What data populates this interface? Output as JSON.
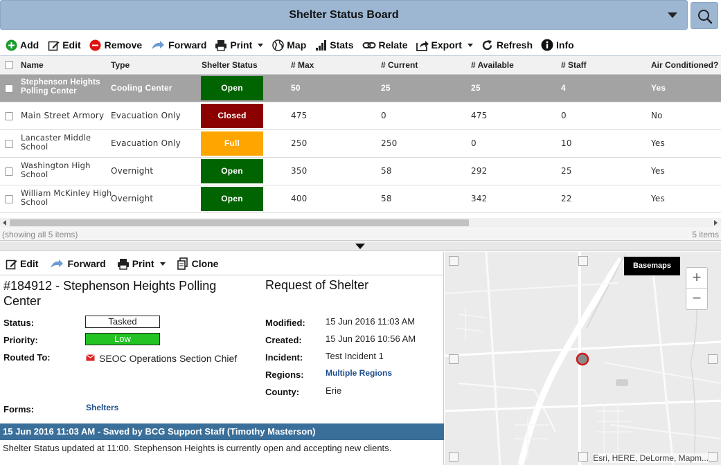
{
  "header": {
    "title": "Shelter Status Board"
  },
  "toolbar": {
    "add": "Add",
    "edit": "Edit",
    "remove": "Remove",
    "forward": "Forward",
    "print": "Print",
    "map": "Map",
    "stats": "Stats",
    "relate": "Relate",
    "export": "Export",
    "refresh": "Refresh",
    "info": "Info"
  },
  "grid": {
    "columns": [
      "Name",
      "Type",
      "Shelter Status",
      "# Max",
      "# Current",
      "# Available",
      "# Staff",
      "Air Conditioned?"
    ],
    "rows": [
      {
        "name1": "Stephenson Heights",
        "name2": "Polling Center",
        "type": "Cooling Center",
        "status": "Open",
        "max": "50",
        "current": "25",
        "available": "25",
        "staff": "4",
        "ac": "Yes"
      },
      {
        "name1": "Main Street Armory",
        "name2": "",
        "type": "Evacuation Only",
        "status": "Closed",
        "max": "475",
        "current": "0",
        "available": "475",
        "staff": "0",
        "ac": "No"
      },
      {
        "name1": "Lancaster Middle",
        "name2": "School",
        "type": "Evacuation Only",
        "status": "Full",
        "max": "250",
        "current": "250",
        "available": "0",
        "staff": "10",
        "ac": "Yes"
      },
      {
        "name1": "Washington High",
        "name2": "School",
        "type": "Overnight",
        "status": "Open",
        "max": "350",
        "current": "58",
        "available": "292",
        "staff": "25",
        "ac": "Yes"
      },
      {
        "name1": "William McKinley High",
        "name2": "School",
        "type": "Overnight",
        "status": "Open",
        "max": "400",
        "current": "58",
        "available": "342",
        "staff": "22",
        "ac": "Yes"
      }
    ],
    "showing": "(showing all 5 items)",
    "count": "5 items"
  },
  "colors": {
    "open": "#006400",
    "closed": "#8b0000",
    "full": "#ffa500",
    "low": "#22c322",
    "header": "#9db7d3",
    "history": "#3a6f9a"
  },
  "detail": {
    "toolbar": {
      "edit": "Edit",
      "forward": "Forward",
      "print": "Print",
      "clone": "Clone"
    },
    "title": "#184912 - Stephenson Heights Polling Center",
    "form_type": "Request of Shelter",
    "status_label": "Status:",
    "status": "Tasked",
    "priority_label": "Priority:",
    "priority": "Low",
    "routed_label": "Routed To:",
    "routed": "SEOC Operations Section Chief",
    "forms_label": "Forms:",
    "forms": "Shelters",
    "modified_label": "Modified:",
    "modified": "15 Jun 2016 11:03 AM",
    "created_label": "Created:",
    "created": "15 Jun 2016 10:56 AM",
    "incident_label": "Incident:",
    "incident": "Test Incident 1",
    "regions_label": "Regions:",
    "regions": "Multiple Regions",
    "county_label": "County:",
    "county": "Erie",
    "history_header": "15 Jun 2016 11:03 AM - Saved by BCG Support Staff (Timothy Masterson)",
    "history_text": "Shelter Status updated at 11:00.  Stephenson Heights is currently open and accepting new clients."
  },
  "map": {
    "basemaps": "Basemaps",
    "zoom_in": "+",
    "zoom_out": "−",
    "attribution": "Esri, HERE, DeLorme, Mapm..."
  }
}
